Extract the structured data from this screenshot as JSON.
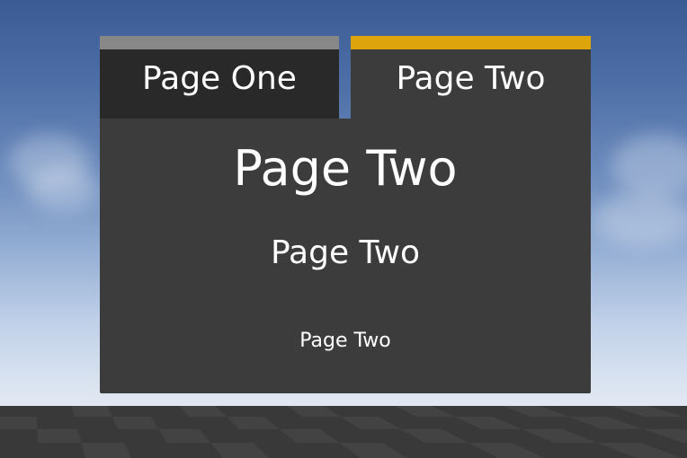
{
  "tabs": [
    {
      "label": "Page One",
      "selected": false,
      "strip_color": "#878787"
    },
    {
      "label": "Page Two",
      "selected": true,
      "strip_color": "#dea40b"
    }
  ],
  "content": {
    "heading_large": "Page Two",
    "heading_medium": "Page Two",
    "heading_small": "Page Two"
  },
  "colors": {
    "accent": "#dea40b",
    "panel": "#3c3c3c",
    "inactive_tab": "#292929",
    "text": "#ffffff"
  }
}
